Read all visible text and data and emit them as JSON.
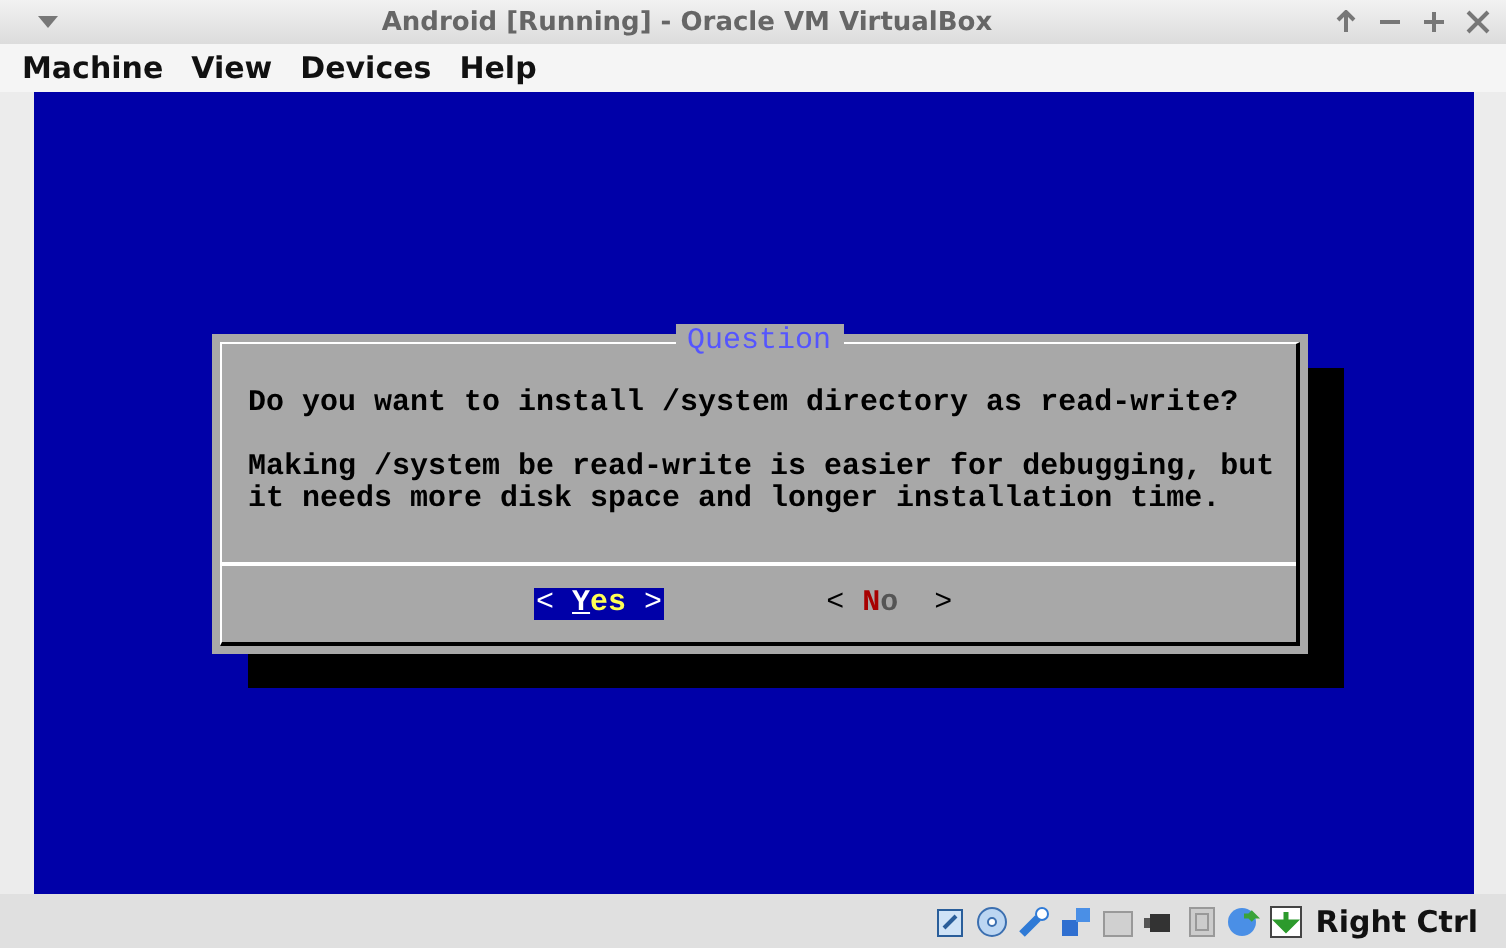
{
  "window": {
    "title": "Android [Running] - Oracle VM VirtualBox"
  },
  "menu": [
    "Machine",
    "View",
    "Devices",
    "Help"
  ],
  "dialog": {
    "title": "Question",
    "question": "Do you want to install /system directory as read-write?",
    "details": [
      "Making /system be read-write is easier for debugging, but",
      "it needs more disk space and longer installation time."
    ],
    "buttons": [
      {
        "label": "Yes",
        "left": "<",
        "right": ">",
        "selected": true
      },
      {
        "label": "No",
        "left": "<",
        "right": ">",
        "selected": false
      }
    ]
  },
  "status_bar": {
    "host_key": "Right Ctrl"
  }
}
